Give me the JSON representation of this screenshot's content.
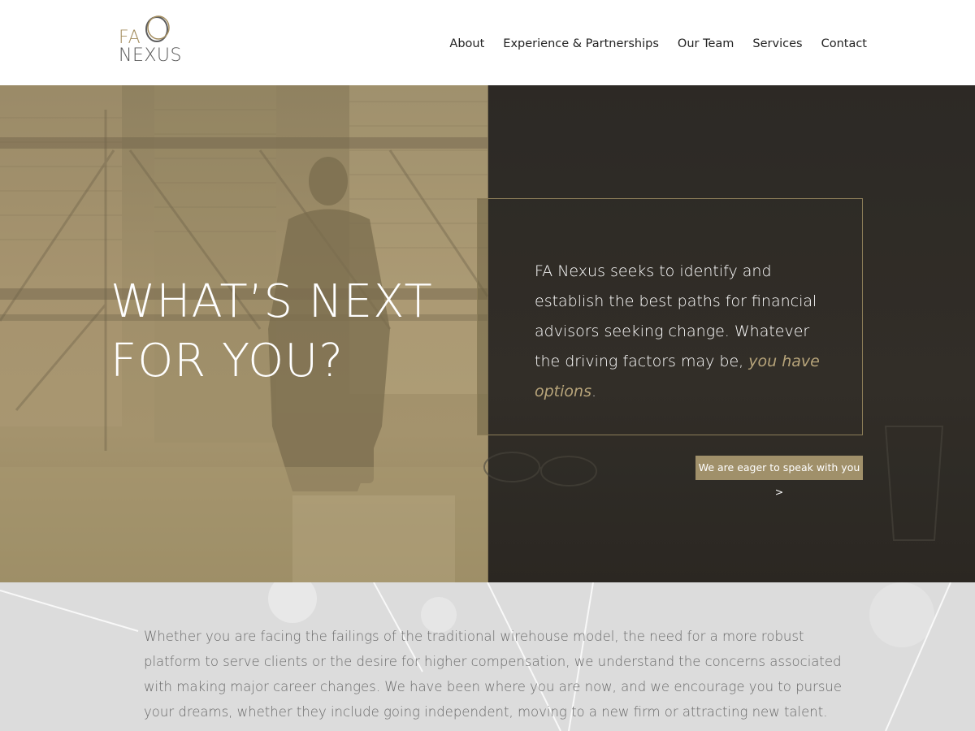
{
  "brand": {
    "logo_top": "FA",
    "logo_bottom": "NEXUS",
    "accent_color": "#a58f61"
  },
  "nav": {
    "items": [
      {
        "label": "About"
      },
      {
        "label": "Experience & Partnerships"
      },
      {
        "label": "Our Team"
      },
      {
        "label": "Services"
      },
      {
        "label": "Contact"
      }
    ]
  },
  "hero": {
    "headline_line1": "WHAT’S NEXT",
    "headline_line2": "FOR YOU?",
    "intro_text": "FA Nexus seeks to identify and establish the best paths for financial advisors seeking change. Whatever the driving factors may be,",
    "intro_emphasis": "you have options",
    "intro_end": ".",
    "cta_label": "We are eager to speak with you >"
  },
  "lower": {
    "body_text": "Whether you are facing the failings of the traditional wirehouse model, the need for a more robust platform to serve clients or the desire for higher compensation, we understand the concerns associated with making major career changes. We have been where you are now, and we encourage you to pursue your dreams, whether they include going independent, moving to a new firm or attracting new talent. Many advisors, unsatisfied with their current situations,"
  }
}
